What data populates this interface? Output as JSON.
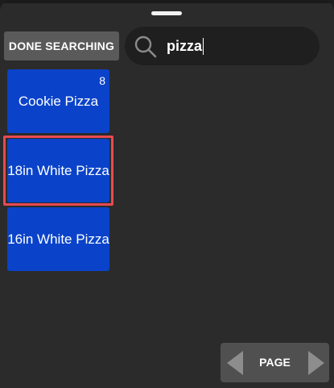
{
  "toolbar": {
    "done_label": "DONE SEARCHING"
  },
  "search": {
    "value": "pizza",
    "icon": "search-icon"
  },
  "results": [
    {
      "label": "Cookie Pizza",
      "badge": "8",
      "selected": false
    },
    {
      "label": "18in White Pizza",
      "badge": "",
      "selected": true
    },
    {
      "label": "16in White Pizza",
      "badge": "",
      "selected": false
    }
  ],
  "pager": {
    "label": "PAGE",
    "prev_icon": "triangle-left-icon",
    "next_icon": "triangle-right-icon"
  },
  "colors": {
    "background": "#2b2b2b",
    "tile": "#0a43c9",
    "selection_ring": "#e84a52",
    "button": "#5a5a5a",
    "search_bar": "#1f1f1f"
  }
}
